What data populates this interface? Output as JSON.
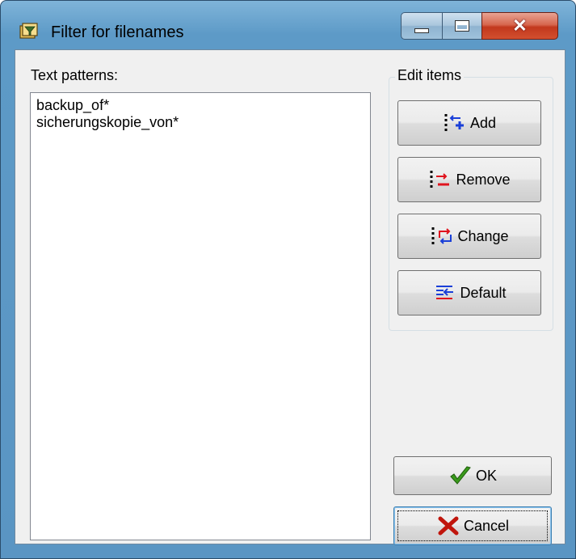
{
  "window": {
    "title": "Filter for filenames",
    "icon": "filter-app-icon",
    "controls": {
      "minimize": "minimize-icon",
      "maximize": "maximize-icon",
      "close": "close-icon"
    }
  },
  "patterns": {
    "label": "Text patterns:",
    "items": [
      "backup_of*",
      "sicherungskopie_von*"
    ]
  },
  "edit_items": {
    "title": "Edit items",
    "add_label": "Add",
    "remove_label": "Remove",
    "change_label": "Change",
    "default_label": "Default"
  },
  "dialog_buttons": {
    "ok_label": "OK",
    "cancel_label": "Cancel"
  },
  "colors": {
    "titlebar": "#5d9ac7",
    "close_button": "#c2381d",
    "ok_check": "#3a9a1c",
    "cancel_x": "#c0150c"
  }
}
